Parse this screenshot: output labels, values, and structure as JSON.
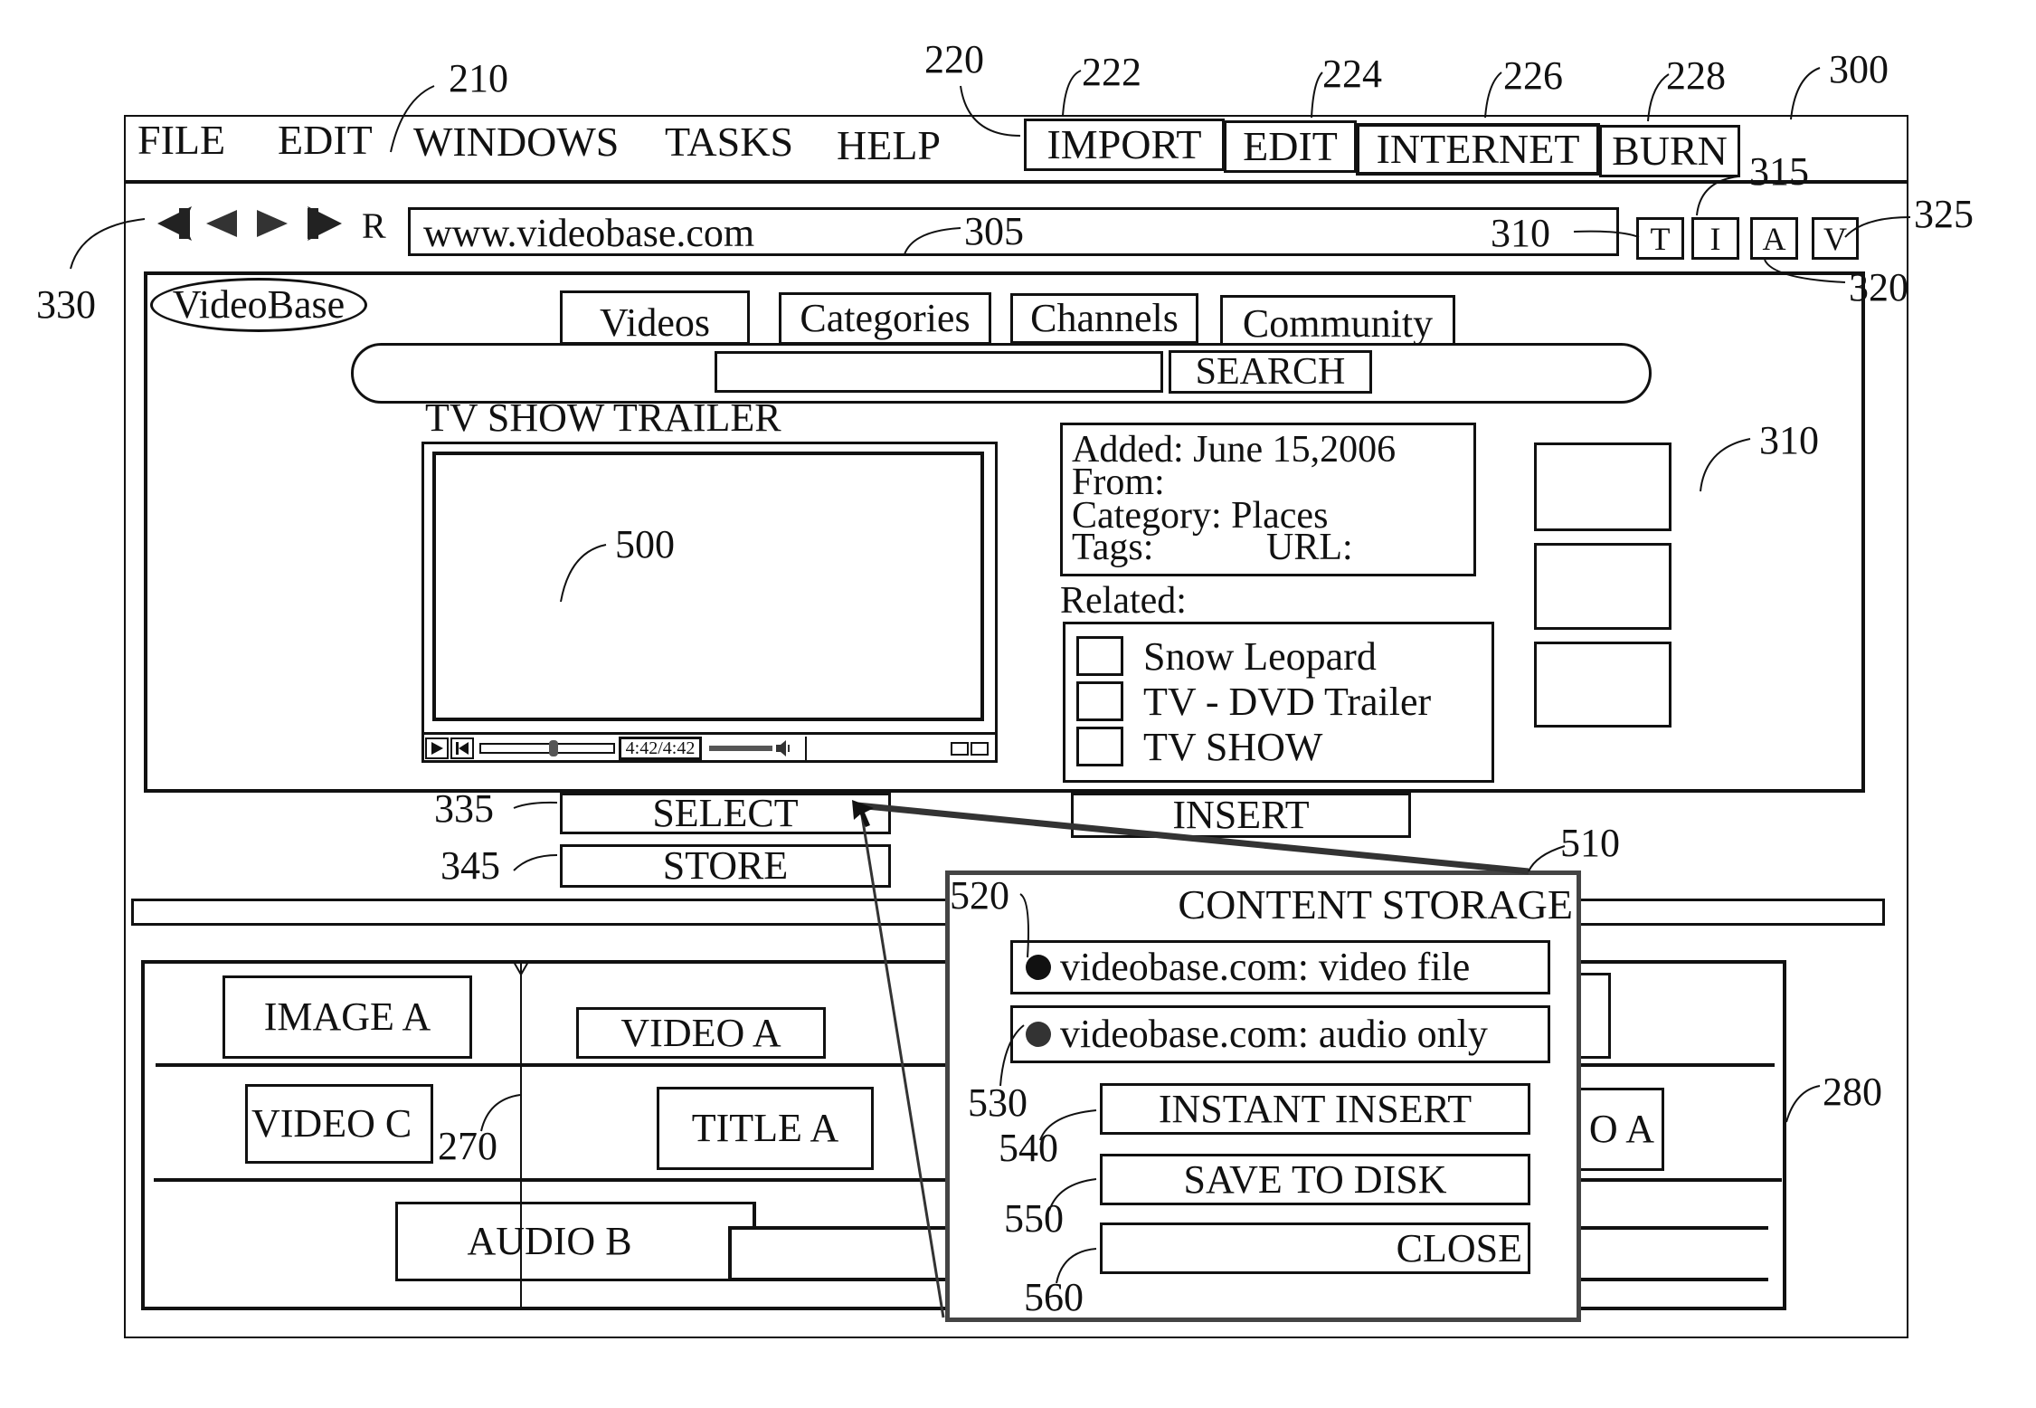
{
  "menubar": {
    "items": [
      "FILE",
      "EDIT",
      "WINDOWS",
      "TASKS",
      "HELP"
    ],
    "toolbar": [
      "IMPORT",
      "EDIT",
      "INTERNET",
      "BURN"
    ]
  },
  "navbar": {
    "buttons": [
      "first-icon",
      "back-icon",
      "forward-icon",
      "last-icon"
    ],
    "refresh_label": "R",
    "url": "www.videobase.com",
    "url_ref": "310",
    "mode_buttons": [
      "T",
      "I",
      "A",
      "V"
    ]
  },
  "site": {
    "logo": "VideoBase",
    "tabs": [
      "Videos",
      "Categories",
      "Channels",
      "Community"
    ],
    "search_value": "",
    "search_button": "SEARCH",
    "video_title": "TV SHOW TRAILER",
    "player": {
      "time": "4:42/4:42",
      "seek_progress": 0.55,
      "volume": 0.85
    },
    "info": {
      "added": "Added: June 15,2006",
      "from": "From:",
      "category": "Category: Places",
      "tags": "Tags:",
      "url": "URL:"
    },
    "related_label": "Related:",
    "related": [
      "Snow Leopard",
      "TV - DVD Trailer",
      "TV SHOW"
    ]
  },
  "actions": {
    "select": "SELECT",
    "store": "STORE",
    "insert": "INSERT"
  },
  "timeline": {
    "clips": {
      "image_a": "IMAGE A",
      "video_a": "VIDEO A",
      "video_c": "VIDEO C",
      "title_a": "TITLE A",
      "audio_b": "AUDIO B",
      "partial": "O A"
    }
  },
  "dialog": {
    "title": "CONTENT STORAGE",
    "options": [
      "videobase.com: video file",
      "videobase.com: audio only"
    ],
    "buttons": {
      "instant_insert": "INSTANT INSERT",
      "save_to_disk": "SAVE TO DISK",
      "close": "CLOSE"
    }
  },
  "reference_numerals": {
    "n210": "210",
    "n220": "220",
    "n222": "222",
    "n224": "224",
    "n226": "226",
    "n228": "228",
    "n300": "300",
    "n305": "305",
    "n310": "310",
    "n315": "315",
    "n320": "320",
    "n325": "325",
    "n330": "330",
    "n335": "335",
    "n345": "345",
    "n500": "500",
    "n510": "510",
    "n520": "520",
    "n530": "530",
    "n540": "540",
    "n550": "550",
    "n560": "560",
    "n270": "270",
    "n280": "280"
  }
}
